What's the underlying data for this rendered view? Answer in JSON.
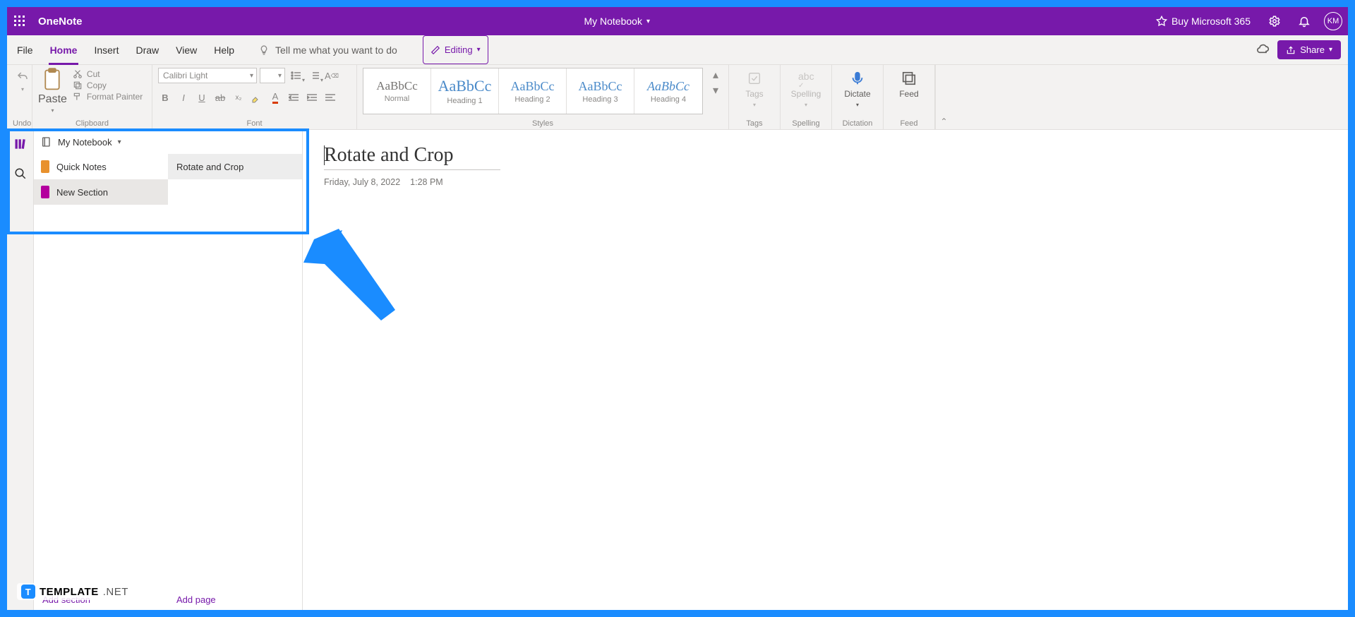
{
  "titlebar": {
    "app_name": "OneNote",
    "notebook_name": "My Notebook",
    "buy_label": "Buy Microsoft 365",
    "avatar_initials": "KM"
  },
  "menu": {
    "tabs": [
      "File",
      "Home",
      "Insert",
      "Draw",
      "View",
      "Help"
    ],
    "active_index": 1,
    "tell_me_placeholder": "Tell me what you want to do",
    "editing_label": "Editing",
    "share_label": "Share"
  },
  "ribbon": {
    "undo_label": "Undo",
    "paste_label": "Paste",
    "cut_label": "Cut",
    "copy_label": "Copy",
    "format_painter_label": "Format Painter",
    "clipboard_group": "Clipboard",
    "font_name": "Calibri Light",
    "font_group": "Font",
    "styles_group": "Styles",
    "styles": [
      {
        "sample": "AaBbCc",
        "label": "Normal",
        "cls": ""
      },
      {
        "sample": "AaBbCc",
        "label": "Heading 1",
        "cls": "accent"
      },
      {
        "sample": "AaBbCc",
        "label": "Heading 2",
        "cls": "accent-sm"
      },
      {
        "sample": "AaBbCc",
        "label": "Heading 3",
        "cls": "accent-sm"
      },
      {
        "sample": "AaBbCc",
        "label": "Heading 4",
        "cls": "ital"
      }
    ],
    "tags_label": "Tags",
    "tags_group": "Tags",
    "spelling_label": "Spelling",
    "spelling_group": "Spelling",
    "dictate_label": "Dictate",
    "dictation_group": "Dictation",
    "feed_label": "Feed",
    "feed_group": "Feed"
  },
  "nav": {
    "notebook_label": "My Notebook",
    "sections": [
      {
        "label": "Quick Notes",
        "color": "#e8912d",
        "selected": false
      },
      {
        "label": "New Section",
        "color": "#b4009e",
        "selected": true
      }
    ],
    "pages": [
      {
        "label": "Rotate and Crop",
        "selected": true
      }
    ],
    "add_section": "Add section",
    "add_page": "Add page"
  },
  "page": {
    "title": "Rotate and Crop",
    "date": "Friday, July 8, 2022",
    "time": "1:28 PM"
  },
  "watermark": {
    "brand": "TEMPLATE",
    "suffix": ".NET"
  }
}
